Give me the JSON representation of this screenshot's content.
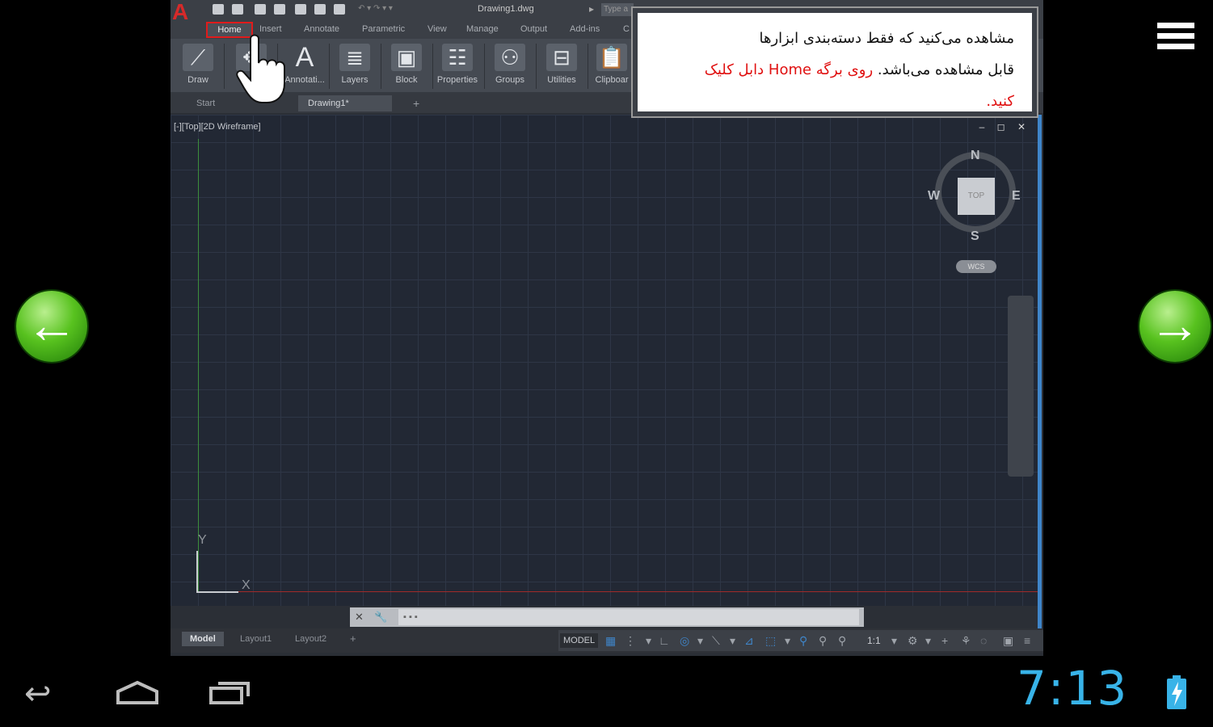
{
  "cad": {
    "file_title": "Drawing1.dwg",
    "search_placeholder": "Type a",
    "ribbon_tabs": [
      "Home",
      "Insert",
      "Annotate",
      "Parametric",
      "View",
      "Manage",
      "Output",
      "Add-ins",
      "C"
    ],
    "ribbon_buttons": [
      "Draw",
      "Mo",
      "Annotati...",
      "Layers",
      "Block",
      "Properties",
      "Groups",
      "Utilities",
      "Clipboar"
    ],
    "file_tabs": [
      "Start",
      "Drawing1*"
    ],
    "viewport_label": "[-][Top][2D Wireframe]",
    "viewport_controls": "– ◻ ✕",
    "ucs": {
      "x": "X",
      "y": "Y"
    },
    "viewcube": {
      "top": "TOP",
      "n": "N",
      "s": "S",
      "e": "E",
      "w": "W",
      "wcs": "WCS"
    },
    "command_prompt": "▪ ▪ ▪",
    "layout_tabs": [
      "Model",
      "Layout1",
      "Layout2"
    ],
    "status_model": "MODEL",
    "status_scale": "1:1"
  },
  "popup": {
    "line1": "مشاهده می‌کنید که فقط دسته‌بندی ابزارها",
    "line2_black": "قابل مشاهده می‌باشد.",
    "line2_red": "روی برگه Home دابل کلیک",
    "line3_red": "کنید."
  },
  "nav": {
    "prev": "←",
    "next": "→"
  },
  "android": {
    "clock": "7:13",
    "back_glyph": "↩"
  },
  "colors": {
    "highlight": "#e01b1b",
    "clock": "#38b3e8",
    "nav_green": "#58c21f"
  }
}
